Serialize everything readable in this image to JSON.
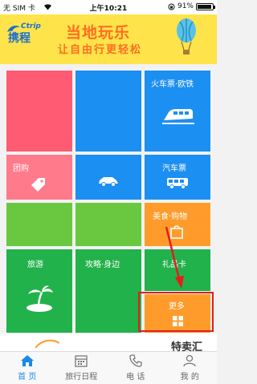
{
  "status_bar": {
    "carrier": "无 SIM 卡 ",
    "time": "上午10:21",
    "battery": "91%"
  },
  "banner": {
    "logo_en": "Ctrip",
    "logo_cn": "携程",
    "headline": "当地玩乐",
    "tagline": "让自由行更轻松"
  },
  "tiles": {
    "train_euro": "火车票·欧铁",
    "group_buy": "团购",
    "bus": "汽车票",
    "food_shopping": "美食·购物",
    "tour": "旅游",
    "guide_nearby": "攻略·身边",
    "gift_card": "礼品卡",
    "more": "更多"
  },
  "special": "特卖汇",
  "tabs": [
    {
      "label": "首 页",
      "icon": "home-icon",
      "active": true
    },
    {
      "label": "旅行日程",
      "icon": "calendar-icon",
      "active": false
    },
    {
      "label": "电 话",
      "icon": "phone-icon",
      "active": false
    },
    {
      "label": "我 的",
      "icon": "person-icon",
      "active": false
    }
  ],
  "colors": {
    "banner_bg": "#ffe34a",
    "highlight": "#e51d1d",
    "active_tab": "#1a8ae6"
  }
}
